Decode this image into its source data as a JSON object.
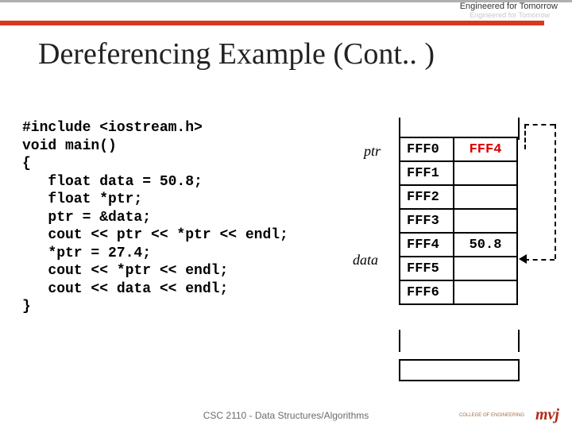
{
  "header": {
    "tagline": "Engineered for Tomorrow",
    "sub_tagline": "Engineered for Tomorrow"
  },
  "title": "Dereferencing Example (Cont.. )",
  "code": {
    "l1": "#include <iostream.h>",
    "l2": "",
    "l3": "void main()",
    "l4": "{",
    "l5": "   float data = 50.8;",
    "l6": "   float *ptr;",
    "l7": "   ptr = &data;",
    "l8": "   cout << ptr << *ptr << endl;",
    "l9": "   *ptr = 27.4;",
    "l10": "   cout << *ptr << endl;",
    "l11": "   cout << data << endl;",
    "l12": "}"
  },
  "labels": {
    "ptr": "ptr",
    "data": "data"
  },
  "memory": [
    {
      "addr": "FFF0",
      "val": "FFF4",
      "val_red": true
    },
    {
      "addr": "FFF1",
      "val": ""
    },
    {
      "addr": "FFF2",
      "val": ""
    },
    {
      "addr": "FFF3",
      "val": ""
    },
    {
      "addr": "FFF4",
      "val": "50.8"
    },
    {
      "addr": "FFF5",
      "val": ""
    },
    {
      "addr": "FFF6",
      "val": ""
    }
  ],
  "footer": "CSC 2110 - Data Structures/Algorithms",
  "logo": {
    "main": "mvj",
    "sub": "COLLEGE OF\nENGINEERING"
  }
}
